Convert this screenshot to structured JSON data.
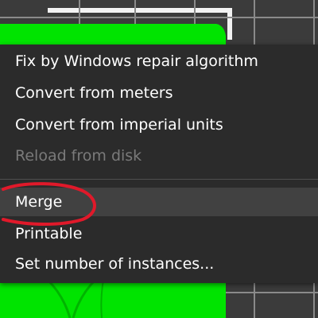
{
  "context_menu": {
    "items": [
      {
        "label": "Fix by Windows repair algorithm",
        "enabled": true
      },
      {
        "label": "Convert from meters",
        "enabled": true
      },
      {
        "label": "Convert from imperial units",
        "enabled": true
      },
      {
        "label": "Reload from disk",
        "enabled": false
      },
      {
        "label": "Merge",
        "enabled": true,
        "hovered": true
      },
      {
        "label": "Printable",
        "enabled": true
      },
      {
        "label": "Set number of instances...",
        "enabled": true
      }
    ]
  },
  "colors": {
    "menu_background": "#2b2b2b",
    "hover_background": "#414141",
    "text": "#ffffff",
    "disabled_text": "#7a7a7a",
    "object_green": "#00e400",
    "annotation_red": "#e0192a"
  }
}
